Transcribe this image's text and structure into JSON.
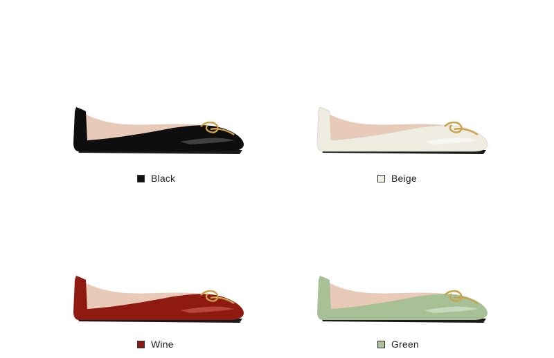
{
  "products": [
    {
      "color_name": "Black",
      "swatch": "#111111",
      "upper": "#0e0e0e",
      "shine": "#6a6a6a",
      "lining": "#e9c9b8",
      "sole": "#1a1a1a"
    },
    {
      "color_name": "Beige",
      "swatch": "#f1efe6",
      "upper": "#efece2",
      "shine": "#ffffff",
      "lining": "#e9c9b8",
      "sole": "#1a1a1a"
    },
    {
      "color_name": "Wine",
      "swatch": "#8a1a14",
      "upper": "#8f1a12",
      "shine": "#d86a5e",
      "lining": "#e9c9b8",
      "sole": "#1a1a1a"
    },
    {
      "color_name": "Green",
      "swatch": "#a9c29a",
      "upper": "#a7c095",
      "shine": "#e0ecd6",
      "lining": "#e9c9b8",
      "sole": "#1a1a1a"
    }
  ],
  "buckle_color": "#c9a24a"
}
